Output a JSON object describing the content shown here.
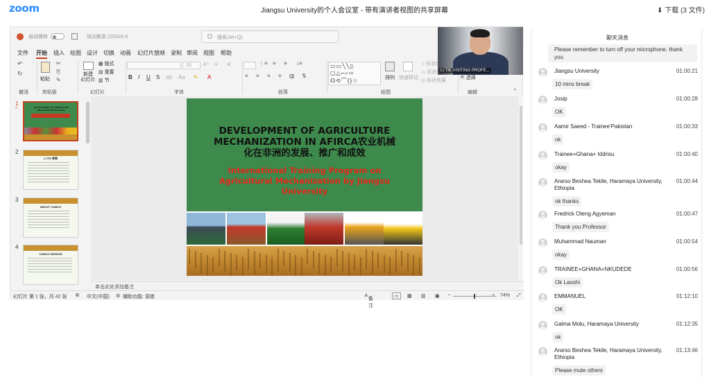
{
  "app": {
    "logo": "zoom",
    "meeting_title": "Jiangsu University的个人会议室 - 带有演讲者视图的共享屏幕",
    "download": "下载 (3 文件)"
  },
  "ppt": {
    "autosave": "自动保存",
    "filename": "培训教案 220329 8",
    "search_placeholder": "搜索(Alt+Q)",
    "menu": [
      "文件",
      "开始",
      "插入",
      "绘图",
      "设计",
      "切换",
      "动画",
      "幻灯片放映",
      "录制",
      "审阅",
      "视图",
      "帮助"
    ],
    "active_menu": "开始",
    "ribbon": {
      "undo_group": "撤消",
      "clipboard_group": "剪贴板",
      "paste": "粘贴",
      "slides_group": "幻灯片",
      "new_slide": "新建\n幻灯片",
      "layout": "版式",
      "reset": "重置",
      "section": "节",
      "font_group": "字体",
      "font_size": "28",
      "paragraph_group": "段落",
      "drawing_group": "绘图",
      "arrange": "排列",
      "quick_styles": "快速样式",
      "shape_fill": "形状填充",
      "shape_outline": "形状轮廓",
      "shape_effects": "形状效果",
      "editing_group": "编辑",
      "select": "选择"
    },
    "thumbnails": [
      {
        "num": "1",
        "title": "DEVELOPMENT OF AGRICULTURE MECHANIZATION IN AFIRCA",
        "selected": true
      },
      {
        "num": "2",
        "title": "LI TIE 李铁",
        "selected": false
      },
      {
        "num": "3",
        "title": "ABOUT CAMCO",
        "selected": false
      },
      {
        "num": "4",
        "title": "CAMCO MISSION",
        "selected": false
      }
    ],
    "slide": {
      "title_line1": "DEVELOPMENT OF AGRICULTURE",
      "title_line2": "MECHANIZATION IN AFIRCA农业机械",
      "title_line3": "化在非洲的发展、推广和成效",
      "subtitle": "International Training Program on Agricultural Mechanization by Jiangsu University"
    },
    "notes_placeholder": "单击此处添加备注",
    "status": {
      "slide_count": "幻灯片 第 1 张，共 42 张",
      "language": "中文(中国)",
      "accessibility": "辅助功能: 调查",
      "notes": "备注",
      "zoom": "74%"
    }
  },
  "video": {
    "label": "LI TIE VISITING PROFE..."
  },
  "chat": {
    "header": "聊天消息",
    "first_text": "Please remember to turn off your microphone. thank you",
    "messages": [
      {
        "sender": "Jiangsu University",
        "time": "01:00:21",
        "text": "10 mins break"
      },
      {
        "sender": "Josip",
        "time": "01:00:28",
        "text": "OK"
      },
      {
        "sender": "Aamir Saeed - Trainee'Pakistan",
        "time": "01:00:33",
        "text": "ok"
      },
      {
        "sender": "Trainee+Ghana+ Iddrisu",
        "time": "01:00:40",
        "text": "okay"
      },
      {
        "sender": "Ararso Beshea Tekile, Haramaya University, Ethiopia",
        "time": "01:00:44",
        "text": "ok thanks"
      },
      {
        "sender": "Fredrick Oteng Agyeman",
        "time": "01:00:47",
        "text": "Thank you Professor"
      },
      {
        "sender": "Muhammad Nauman",
        "time": "01:00:54",
        "text": "okay"
      },
      {
        "sender": "TRAINEE+GHANA+NKUDEDE",
        "time": "01:00:56",
        "text": "Ok Laoshi"
      },
      {
        "sender": "EMMANUEL",
        "time": "01:12:10",
        "text": "OK"
      },
      {
        "sender": "Galma Molu, Haramaya University",
        "time": "01:12:35",
        "text": "ok"
      },
      {
        "sender": "Ararso Beshea Tekile, Haramaya University, Ethiopia",
        "time": "01:13:46",
        "text": "Please mute others"
      }
    ]
  },
  "colors": {
    "zoom_blue": "#2D8CFF",
    "ppt_accent": "#c43e1c",
    "slide_green": "#3e8a4c",
    "slide_subtitle_red": "#e2281b"
  }
}
